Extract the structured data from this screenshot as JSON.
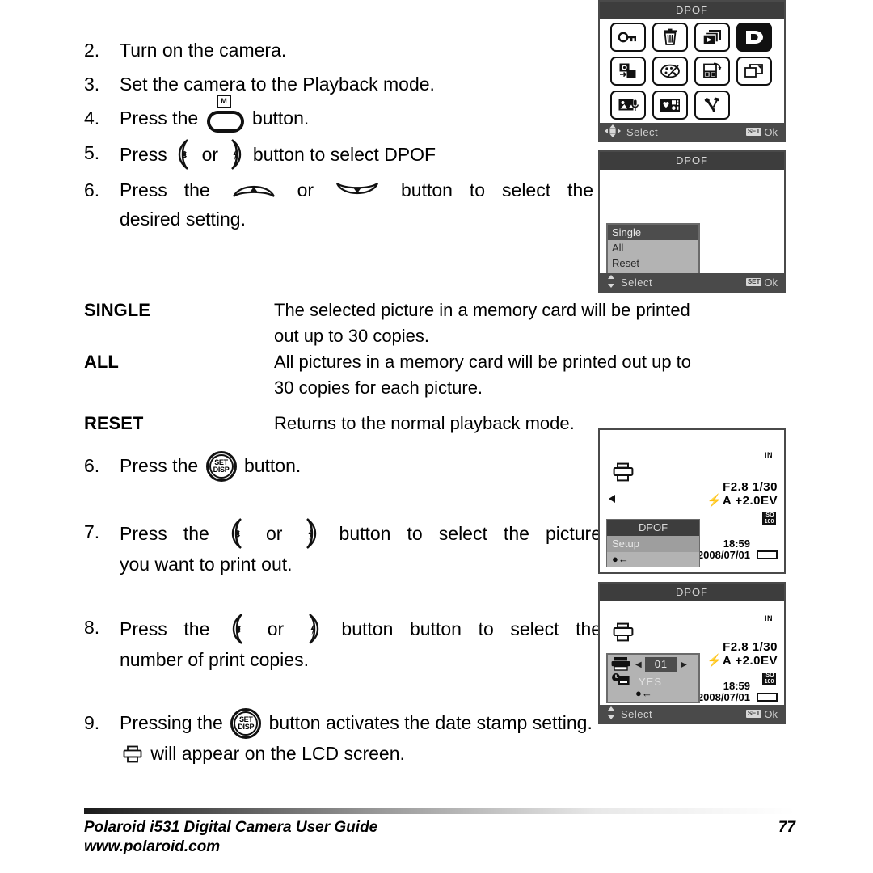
{
  "steps_top": [
    {
      "num": "2.",
      "text": "Turn on the camera."
    },
    {
      "num": "3.",
      "text": "Set the camera to the Playback mode."
    },
    {
      "num": "4.",
      "pre": "Press the",
      "post": "button.",
      "button_label": "M"
    },
    {
      "num": "5.",
      "pre": "Press",
      "mid": "or",
      "post": "button to select DPOF"
    },
    {
      "num": "6.",
      "pre": "Press",
      "word_the": "the",
      "mid": "or",
      "post": "button to select the",
      "line2": "desired setting."
    }
  ],
  "definitions": [
    {
      "term": "SINGLE",
      "desc_line1": "The selected picture in a memory card will be printed",
      "desc_line2": "out up to 30 copies."
    },
    {
      "term": "ALL",
      "desc_line1": "All pictures in a memory card will be printed out up to",
      "desc_line2": "30 copies for each picture."
    },
    {
      "term": "RESET",
      "desc_line1": "Returns to the normal playback mode.",
      "desc_line2": ""
    }
  ],
  "steps_bottom": [
    {
      "num": "6.",
      "pre": "Press the",
      "post": "button.",
      "set_top": "SET",
      "set_bottom": "DISP"
    },
    {
      "num": "7.",
      "pre": "Press the",
      "mid": "or",
      "post": "button to select the picture",
      "line2": "you want to print out."
    },
    {
      "num": "8.",
      "pre": "Press the",
      "mid": "or",
      "post": "button button to select the",
      "line2": "number of print copies."
    },
    {
      "num": "9.",
      "pre": "Pressing the",
      "post": "button activates the date stamp",
      "line2_pre": "setting.",
      "line2_post": "will appear on the LCD screen.",
      "set_top": "SET",
      "set_bottom": "DISP"
    }
  ],
  "lcd1": {
    "title": "DPOF",
    "status_label": "Select",
    "status_badge": "SET",
    "status_ok": "Ok",
    "icons": [
      {
        "name": "protect-key-icon",
        "selected": false
      },
      {
        "name": "delete-trash-icon",
        "selected": false
      },
      {
        "name": "slideshow-icon",
        "selected": false
      },
      {
        "name": "dpof-icon",
        "selected": true
      },
      {
        "name": "copy-icon",
        "selected": false
      },
      {
        "name": "effects-palette-icon",
        "selected": false
      },
      {
        "name": "rotate-icon",
        "selected": false
      },
      {
        "name": "resize-icon",
        "selected": false
      },
      {
        "name": "voice-memo-icon",
        "selected": false
      },
      {
        "name": "favorites-icon",
        "selected": false
      },
      {
        "name": "setup-tools-icon",
        "selected": false
      }
    ]
  },
  "lcd2": {
    "title": "DPOF",
    "menu_items": [
      {
        "label": "Single",
        "selected": true
      },
      {
        "label": "All",
        "selected": false
      },
      {
        "label": "Reset",
        "selected": false
      }
    ],
    "back_marker": "●←",
    "status_label": "Select",
    "status_badge": "SET",
    "status_ok": "Ok"
  },
  "lcd3": {
    "memory_label": "IN",
    "exif_line1": "F2.8  1/30",
    "exif_line2": "A +2.0EV",
    "iso_label": "ISO",
    "iso_value": "100",
    "time": "18:59",
    "date": "2008/07/01",
    "overlay_title": "DPOF",
    "overlay_item": "Setup",
    "overlay_back": "●←"
  },
  "lcd4": {
    "title": "DPOF",
    "memory_label": "IN",
    "exif_line1": "F2.8  1/30",
    "exif_line2": "A +2.0EV",
    "iso_label": "ISO",
    "iso_value": "100",
    "time": "18:59",
    "date": "2008/07/01",
    "copies_value": "01",
    "left_arrow": "◀",
    "right_arrow": "▶",
    "datestamp_value": "YES",
    "back_marker": "●←",
    "status_label": "Select",
    "status_badge": "SET",
    "status_ok": "Ok"
  },
  "footer": {
    "title": "Polaroid i531 Digital Camera User Guide",
    "url": "www.polaroid.com",
    "page": "77"
  }
}
